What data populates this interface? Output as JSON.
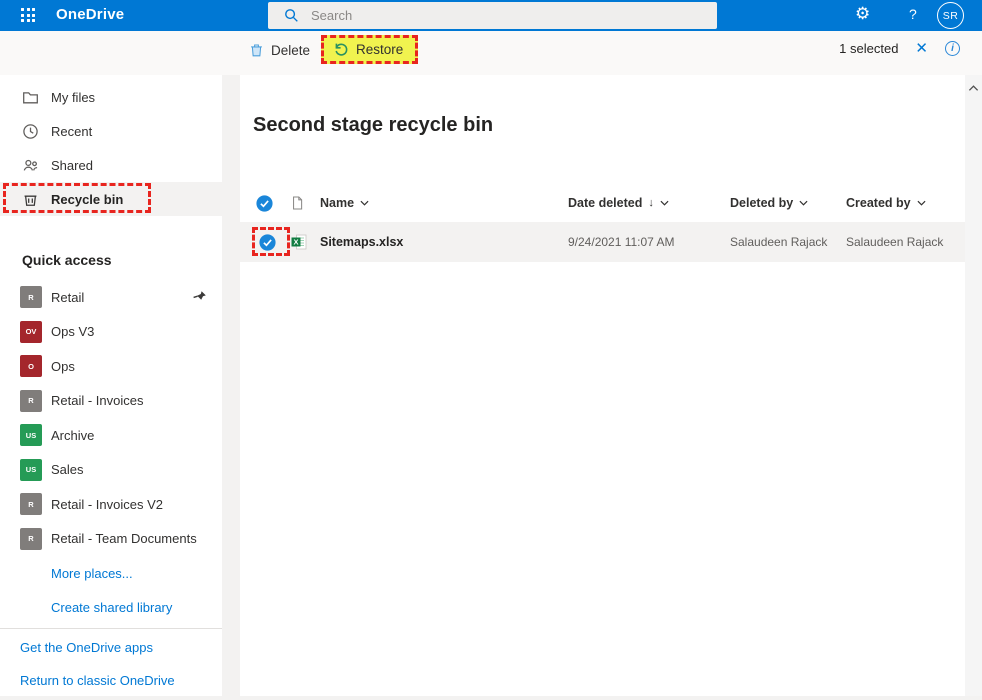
{
  "topbar": {
    "app_title": "OneDrive",
    "search_placeholder": "Search",
    "help_label": "?",
    "avatar_initials": "SR"
  },
  "toolbar": {
    "delete_label": "Delete",
    "restore_label": "Restore",
    "selection_status": "1 selected"
  },
  "sidebar": {
    "nav_items": [
      {
        "label": "My files",
        "icon": "folder-icon",
        "selected": false
      },
      {
        "label": "Recent",
        "icon": "clock-icon",
        "selected": false
      },
      {
        "label": "Shared",
        "icon": "people-icon",
        "selected": false
      },
      {
        "label": "Recycle bin",
        "icon": "recycle-bin-icon",
        "selected": true,
        "annotated": "red-dashed-outline"
      }
    ],
    "quick_access": {
      "header": "Quick access",
      "items": [
        {
          "label": "Retail",
          "tile_text": "R",
          "tile_color": "#807d7b",
          "pinned": true
        },
        {
          "label": "Ops V3",
          "tile_text": "OV",
          "tile_color": "#a4262c",
          "pinned": false
        },
        {
          "label": "Ops",
          "tile_text": "O",
          "tile_color": "#a4262c",
          "pinned": false
        },
        {
          "label": "Retail - Invoices",
          "tile_text": "R",
          "tile_color": "#807d7b",
          "pinned": false
        },
        {
          "label": "Archive",
          "tile_text": "US",
          "tile_color": "#259b56",
          "pinned": false
        },
        {
          "label": "Sales",
          "tile_text": "US",
          "tile_color": "#259b56",
          "pinned": false
        },
        {
          "label": "Retail - Invoices V2",
          "tile_text": "R",
          "tile_color": "#807d7b",
          "pinned": false
        },
        {
          "label": "Retail - Team Documents",
          "tile_text": "R",
          "tile_color": "#807d7b",
          "pinned": false
        }
      ],
      "more_link": "More places...",
      "create_link": "Create shared library"
    },
    "footer_links": [
      {
        "label": "Get the OneDrive apps"
      },
      {
        "label": "Return to classic OneDrive"
      }
    ]
  },
  "main": {
    "title": "Second stage recycle bin",
    "table": {
      "columns": [
        {
          "label": "Name"
        },
        {
          "label": "Date deleted",
          "sorted": "descending"
        },
        {
          "label": "Deleted by"
        },
        {
          "label": "Created by"
        }
      ],
      "rows": [
        {
          "name": "Sitemaps.xlsx",
          "file_type": "xlsx",
          "date_deleted": "9/24/2021 11:07 AM",
          "deleted_by": "Salaudeen Rajack",
          "created_by": "Salaudeen Rajack",
          "selected": true,
          "annotated": "red-dashed-outline-on-checkbox"
        }
      ]
    }
  },
  "colors": {
    "brand_blue": "#0078d4",
    "highlight_yellow": "#f1f34f",
    "annotation_red": "#e8251f",
    "selection_gray": "#f3f2f1",
    "restore_green": "#2a9161",
    "tile_gray": "#807d7b",
    "tile_red": "#a4262c",
    "tile_green": "#259b56"
  }
}
